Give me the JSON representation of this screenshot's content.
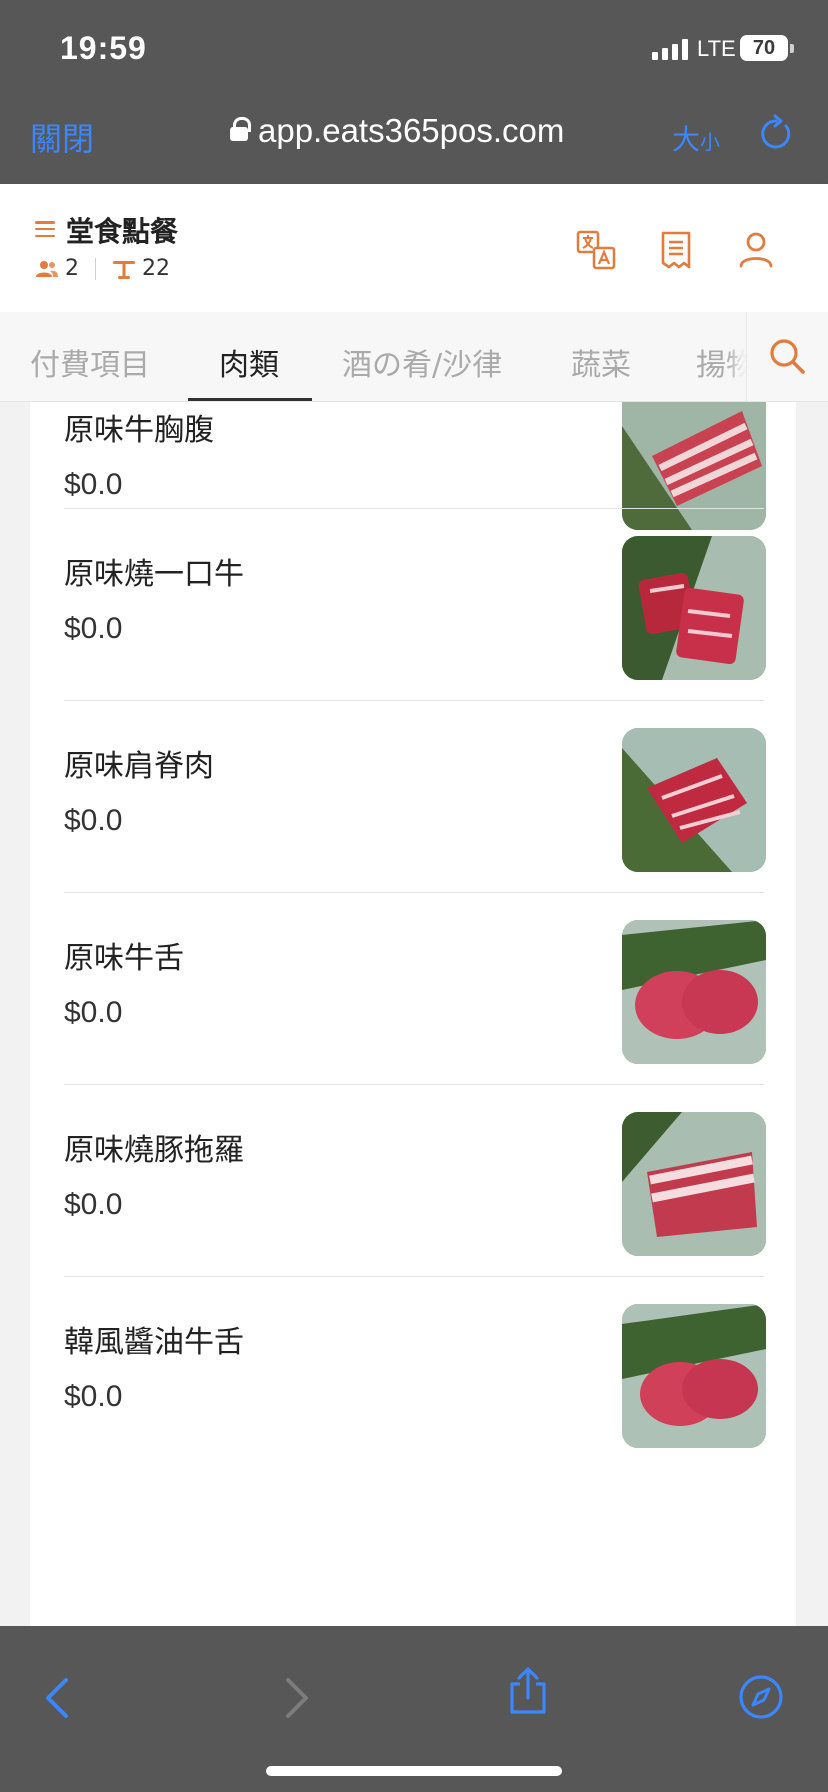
{
  "status_bar": {
    "time": "19:59",
    "network": "LTE",
    "battery": "70"
  },
  "browser": {
    "close_label": "關閉",
    "url": "app.eats365pos.com",
    "text_size_big": "大",
    "text_size_small": "小",
    "accent_color": "#3b87ff"
  },
  "header": {
    "title": "堂食點餐",
    "guests": "2",
    "table": "22",
    "accent_color": "#e27b3c",
    "icons": [
      "translate-icon",
      "receipt-icon",
      "account-icon"
    ]
  },
  "tabs": [
    {
      "label": "付費項目"
    },
    {
      "label": "肉類"
    },
    {
      "label": "酒の肴/沙律"
    },
    {
      "label": "蔬菜"
    },
    {
      "label": "揚物"
    }
  ],
  "active_tab": "肉類",
  "items": [
    {
      "name": "原味牛胸腹",
      "price": "$0.0"
    },
    {
      "name": "原味燒一口牛",
      "price": "$0.0"
    },
    {
      "name": "原味肩脊肉",
      "price": "$0.0"
    },
    {
      "name": "原味牛舌",
      "price": "$0.0"
    },
    {
      "name": "原味燒豚拖羅",
      "price": "$0.0"
    },
    {
      "name": "韓風醬油牛舌",
      "price": "$0.0"
    }
  ]
}
